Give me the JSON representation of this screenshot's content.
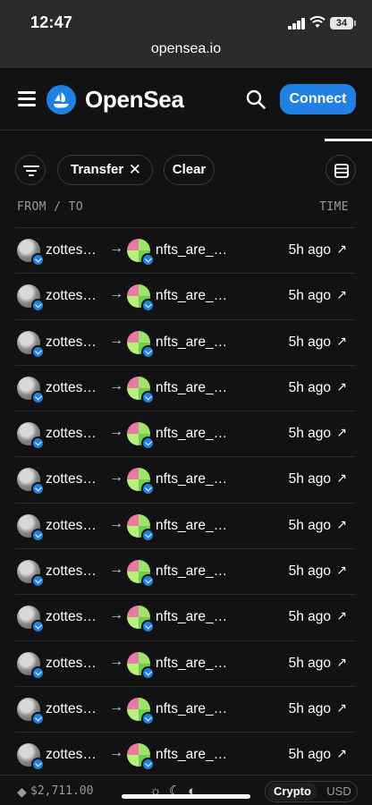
{
  "status_bar": {
    "time": "12:47",
    "battery": "34"
  },
  "browser": {
    "url": "opensea.io"
  },
  "header": {
    "brand": "OpenSea",
    "connect_label": "Connect"
  },
  "filters": {
    "active_chip": "Transfer",
    "clear_label": "Clear"
  },
  "columns": {
    "from_to": "FROM / TO",
    "time": "TIME"
  },
  "rows": [
    {
      "from": "zottes…",
      "to": "nfts_are_…",
      "time": "5h ago"
    },
    {
      "from": "zottes…",
      "to": "nfts_are_…",
      "time": "5h ago"
    },
    {
      "from": "zottes…",
      "to": "nfts_are_…",
      "time": "5h ago"
    },
    {
      "from": "zottes…",
      "to": "nfts_are_…",
      "time": "5h ago"
    },
    {
      "from": "zottes…",
      "to": "nfts_are_…",
      "time": "5h ago"
    },
    {
      "from": "zottes…",
      "to": "nfts_are_…",
      "time": "5h ago"
    },
    {
      "from": "zottes…",
      "to": "nfts_are_…",
      "time": "5h ago"
    },
    {
      "from": "zottes…",
      "to": "nfts_are_…",
      "time": "5h ago"
    },
    {
      "from": "zottes…",
      "to": "nfts_are_…",
      "time": "5h ago"
    },
    {
      "from": "zottes…",
      "to": "nfts_are_…",
      "time": "5h ago"
    },
    {
      "from": "zottes…",
      "to": "nfts_are_…",
      "time": "5h ago"
    },
    {
      "from": "zottes…",
      "to": "nfts_are_…",
      "time": "5h ago"
    }
  ],
  "footer": {
    "eth_price": "$2,711.00",
    "currency_crypto": "Crypto",
    "currency_usd": "USD"
  },
  "colors": {
    "accent": "#2081e2",
    "background": "#121214",
    "chrome": "#2a2a2c"
  },
  "icons": [
    "menu-icon",
    "opensea-logo-icon",
    "search-icon",
    "filter-icon",
    "close-icon",
    "list-view-icon",
    "arrow-right-icon",
    "external-link-icon",
    "verified-badge-icon",
    "ethereum-icon",
    "sun-icon",
    "moon-icon",
    "contrast-icon",
    "signal-icon",
    "wifi-icon",
    "battery-icon"
  ]
}
